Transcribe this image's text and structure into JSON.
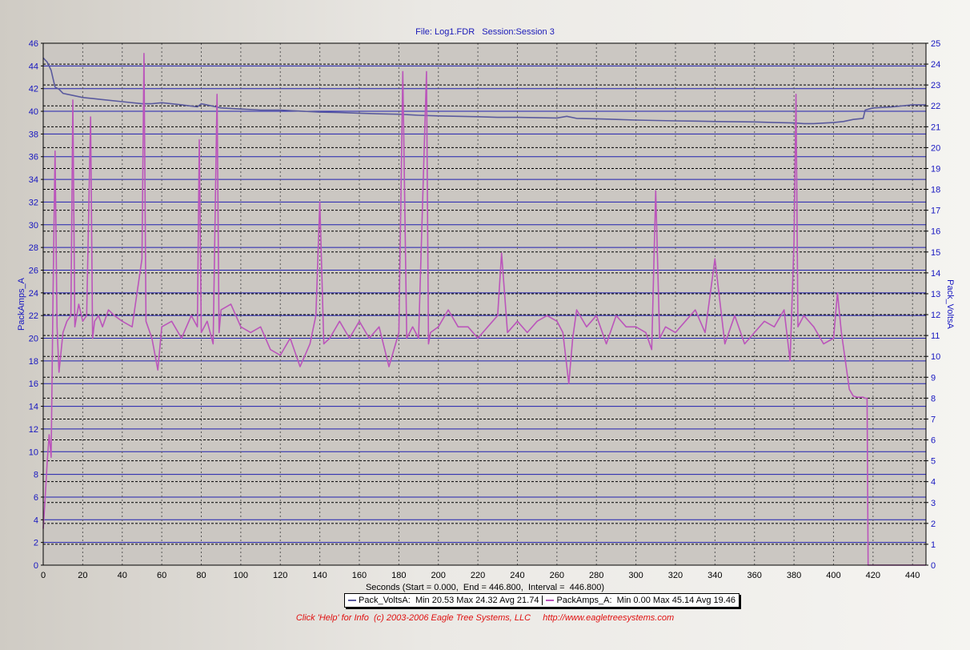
{
  "title": "File: Log1.FDR   Session:Session 3",
  "x_axis_label": "Seconds (Start = 0.000,  End = 446.800,  Interval =  446.800)",
  "footer": "Click 'Help' for Info  (c) 2003-2006 Eagle Tree Systems, LLC     http://www.eagletreesystems.com",
  "colors": {
    "plot_bg": "#cbc7c2",
    "volts_line": "#5a5a9e",
    "amps_line": "#bb55bb",
    "grid_solid": "#2020b0",
    "axis_text": "#1515c0"
  },
  "legend": [
    {
      "name": "Pack_VoltsA",
      "stats": "Min 20.53 Max 24.32 Avg 21.74",
      "color": "#5a5a9e"
    },
    {
      "name": "PackAmps_A",
      "stats": "Min 0.00 Max 45.14 Avg 19.46",
      "color": "#bb55bb"
    }
  ],
  "chart_data": {
    "type": "line",
    "xlim": [
      0,
      446.8
    ],
    "x_ticks": [
      0,
      20,
      40,
      60,
      80,
      100,
      120,
      140,
      160,
      180,
      200,
      220,
      240,
      260,
      280,
      300,
      320,
      340,
      360,
      380,
      400,
      420,
      440
    ],
    "left_axis": {
      "label": "PackAmps_A",
      "ylim": [
        0,
        46
      ],
      "ticks": [
        0,
        2,
        4,
        6,
        8,
        10,
        12,
        14,
        16,
        18,
        20,
        22,
        24,
        26,
        28,
        30,
        32,
        34,
        36,
        38,
        40,
        42,
        44,
        46
      ]
    },
    "right_axis": {
      "label": "Pack_VoltsA",
      "ylim": [
        0,
        25
      ],
      "ticks": [
        0,
        1,
        2,
        3,
        4,
        5,
        6,
        7,
        8,
        9,
        10,
        11,
        12,
        13,
        14,
        15,
        16,
        17,
        18,
        19,
        20,
        21,
        22,
        23,
        24,
        25
      ]
    },
    "grid": true,
    "series": [
      {
        "name": "Pack_VoltsA",
        "axis": "right",
        "x": [
          0,
          2,
          4,
          5,
          6,
          8,
          10,
          15,
          20,
          25,
          30,
          40,
          50,
          55,
          60,
          70,
          78,
          80,
          85,
          90,
          100,
          110,
          120,
          130,
          140,
          150,
          160,
          170,
          180,
          190,
          200,
          210,
          220,
          230,
          240,
          260,
          265,
          270,
          280,
          290,
          300,
          310,
          320,
          330,
          340,
          350,
          360,
          370,
          380,
          385,
          390,
          400,
          405,
          410,
          415,
          416,
          420,
          430,
          440,
          446.8
        ],
        "y": [
          24.3,
          24.1,
          23.7,
          23.3,
          22.9,
          22.8,
          22.6,
          22.5,
          22.4,
          22.35,
          22.3,
          22.2,
          22.1,
          22.1,
          22.15,
          22.05,
          21.95,
          22.1,
          22.0,
          21.9,
          21.85,
          21.8,
          21.8,
          21.75,
          21.7,
          21.68,
          21.65,
          21.62,
          21.6,
          21.55,
          21.52,
          21.5,
          21.48,
          21.45,
          21.45,
          21.42,
          21.5,
          21.4,
          21.38,
          21.35,
          21.32,
          21.3,
          21.28,
          21.27,
          21.25,
          21.24,
          21.23,
          21.2,
          21.18,
          21.15,
          21.15,
          21.2,
          21.25,
          21.35,
          21.4,
          21.8,
          21.9,
          21.95,
          22.05,
          22.05
        ]
      },
      {
        "name": "PackAmps_A",
        "axis": "left",
        "x": [
          0,
          1,
          2,
          3,
          4,
          5,
          6,
          7,
          8,
          10,
          12,
          14,
          15,
          16,
          18,
          20,
          22,
          24,
          25,
          26,
          28,
          30,
          33,
          36,
          40,
          45,
          50,
          51,
          52,
          55,
          58,
          60,
          65,
          70,
          75,
          78,
          79,
          80,
          83,
          86,
          88,
          89,
          90,
          95,
          100,
          105,
          110,
          115,
          120,
          125,
          130,
          135,
          138,
          140,
          142,
          145,
          150,
          155,
          160,
          165,
          170,
          175,
          180,
          182,
          184,
          187,
          190,
          194,
          195,
          196,
          200,
          205,
          210,
          215,
          220,
          225,
          230,
          232,
          235,
          240,
          245,
          250,
          255,
          260,
          263,
          266,
          268,
          270,
          275,
          280,
          285,
          290,
          295,
          300,
          305,
          308,
          310,
          312,
          315,
          320,
          325,
          330,
          335,
          340,
          345,
          350,
          355,
          360,
          365,
          370,
          375,
          378,
          380,
          381,
          382,
          385,
          390,
          395,
          400,
          402,
          404,
          406,
          408,
          410,
          412,
          414,
          415,
          416,
          417,
          417.5,
          446.8
        ],
        "y": [
          3.2,
          6.0,
          9.0,
          11.5,
          9.5,
          24.0,
          36.5,
          21.0,
          17.0,
          20.5,
          21.5,
          22.0,
          41.0,
          21.0,
          23.0,
          21.5,
          22.0,
          39.5,
          20.0,
          21.5,
          22.0,
          21.0,
          22.5,
          22.0,
          21.5,
          21.0,
          27.0,
          45.1,
          21.5,
          20.0,
          17.2,
          21.0,
          21.5,
          20.0,
          22.0,
          21.0,
          37.5,
          20.5,
          21.5,
          19.5,
          41.5,
          20.5,
          22.5,
          23.0,
          21.0,
          20.5,
          21.0,
          19.0,
          18.5,
          20.0,
          17.5,
          19.5,
          22.0,
          32.0,
          19.5,
          20.0,
          21.5,
          20.0,
          21.5,
          20.0,
          21.0,
          17.5,
          20.5,
          43.5,
          20.0,
          21.0,
          20.0,
          43.5,
          19.5,
          20.5,
          21.0,
          22.5,
          21.0,
          21.0,
          20.0,
          21.0,
          22.0,
          27.5,
          20.5,
          21.5,
          20.5,
          21.5,
          22.0,
          21.5,
          20.5,
          16.0,
          20.0,
          22.5,
          21.0,
          22.0,
          19.5,
          22.0,
          21.0,
          21.0,
          20.5,
          19.0,
          33.0,
          20.0,
          21.0,
          20.5,
          21.5,
          22.5,
          20.5,
          27.0,
          19.5,
          22.0,
          19.5,
          20.5,
          21.5,
          21.0,
          22.5,
          18.0,
          28.5,
          41.5,
          21.0,
          22.0,
          21.0,
          19.5,
          20.0,
          24.0,
          20.5,
          18.0,
          15.5,
          14.9,
          14.8,
          14.8,
          14.8,
          14.7,
          14.7,
          0.0,
          0.0
        ]
      }
    ]
  }
}
